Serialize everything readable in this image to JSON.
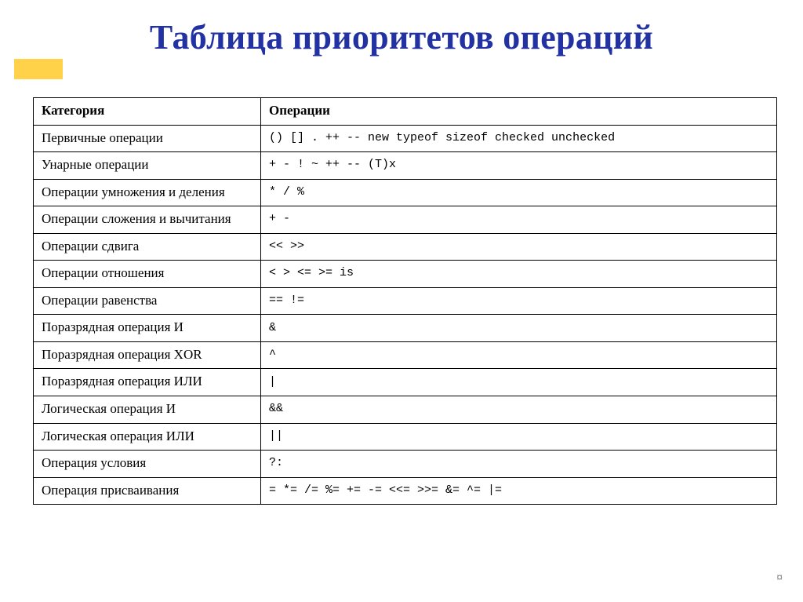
{
  "title": "Таблица приоритетов операций",
  "headers": {
    "category": "Категория",
    "operations": "Операции"
  },
  "rows": [
    {
      "category": "Первичные операции",
      "operations": "()  []  .  ++  --  new  typeof  sizeof  checked  unchecked"
    },
    {
      "category": "Унарные операции",
      "operations": "+  -  !  ~  ++  --  (T)x"
    },
    {
      "category": "Операции умножения и деления",
      "operations": "*  /  %"
    },
    {
      "category": "Операции сложения и вычитания",
      "operations": "+  -"
    },
    {
      "category": "Операции сдвига",
      "operations": "<<  >>"
    },
    {
      "category": "Операции отношения",
      "operations": "<  >  <=  >=  is"
    },
    {
      "category": "Операции равенства",
      "operations": "==  !="
    },
    {
      "category": "Поразрядная операция И",
      "operations": "&"
    },
    {
      "category": "Поразрядная операция XOR",
      "operations": "^"
    },
    {
      "category": "Поразрядная операция ИЛИ",
      "operations": "|"
    },
    {
      "category": "Логическая операция И",
      "operations": "&&"
    },
    {
      "category": "Логическая операция ИЛИ",
      "operations": "||"
    },
    {
      "category": "Операция условия",
      "operations": "?:"
    },
    {
      "category": "Операция присваивания",
      "operations": "=  *=  /=  %=  +=  -=  <<=  >>=  &=  ^=  |="
    }
  ],
  "endmark": "¤"
}
